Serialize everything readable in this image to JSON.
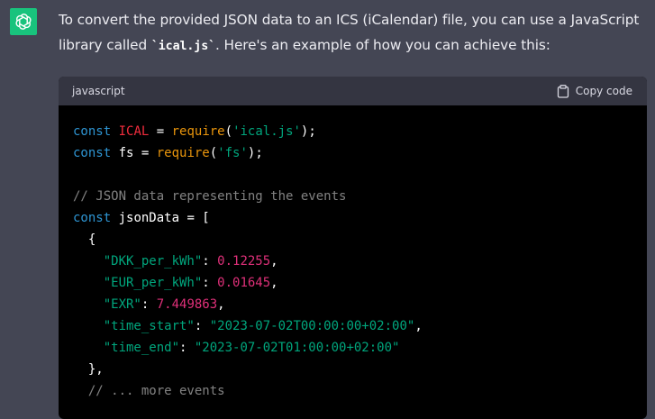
{
  "assistant": {
    "avatar_icon": "openai-logo-icon",
    "avatar_color": "#19c37d"
  },
  "message": {
    "intro_before": "To convert the provided JSON data to an ICS (iCalendar) file, you can use a JavaScript library called ",
    "intro_code": "`ical.js`",
    "intro_after": ". Here's an example of how you can achieve this:"
  },
  "code_block": {
    "language": "javascript",
    "copy_label": "Copy code",
    "copy_icon": "clipboard-icon",
    "lines": [
      [
        {
          "t": "kw",
          "v": "const"
        },
        {
          "t": "pl",
          "v": " "
        },
        {
          "t": "var",
          "v": "ICAL"
        },
        {
          "t": "pl",
          "v": " = "
        },
        {
          "t": "fn",
          "v": "require"
        },
        {
          "t": "pl",
          "v": "("
        },
        {
          "t": "str",
          "v": "'ical.js'"
        },
        {
          "t": "pl",
          "v": ");"
        }
      ],
      [
        {
          "t": "kw",
          "v": "const"
        },
        {
          "t": "pl",
          "v": " fs = "
        },
        {
          "t": "fn",
          "v": "require"
        },
        {
          "t": "pl",
          "v": "("
        },
        {
          "t": "str",
          "v": "'fs'"
        },
        {
          "t": "pl",
          "v": ");"
        }
      ],
      [],
      [
        {
          "t": "cm",
          "v": "// JSON data representing the events"
        }
      ],
      [
        {
          "t": "kw",
          "v": "const"
        },
        {
          "t": "pl",
          "v": " jsonData = ["
        }
      ],
      [
        {
          "t": "pl",
          "v": "  {"
        }
      ],
      [
        {
          "t": "pl",
          "v": "    "
        },
        {
          "t": "str",
          "v": "\"DKK_per_kWh\""
        },
        {
          "t": "pl",
          "v": ": "
        },
        {
          "t": "num",
          "v": "0.12255"
        },
        {
          "t": "pl",
          "v": ","
        }
      ],
      [
        {
          "t": "pl",
          "v": "    "
        },
        {
          "t": "str",
          "v": "\"EUR_per_kWh\""
        },
        {
          "t": "pl",
          "v": ": "
        },
        {
          "t": "num",
          "v": "0.01645"
        },
        {
          "t": "pl",
          "v": ","
        }
      ],
      [
        {
          "t": "pl",
          "v": "    "
        },
        {
          "t": "str",
          "v": "\"EXR\""
        },
        {
          "t": "pl",
          "v": ": "
        },
        {
          "t": "num",
          "v": "7.449863"
        },
        {
          "t": "pl",
          "v": ","
        }
      ],
      [
        {
          "t": "pl",
          "v": "    "
        },
        {
          "t": "str",
          "v": "\"time_start\""
        },
        {
          "t": "pl",
          "v": ": "
        },
        {
          "t": "str",
          "v": "\"2023-07-02T00:00:00+02:00\""
        },
        {
          "t": "pl",
          "v": ","
        }
      ],
      [
        {
          "t": "pl",
          "v": "    "
        },
        {
          "t": "str",
          "v": "\"time_end\""
        },
        {
          "t": "pl",
          "v": ": "
        },
        {
          "t": "str",
          "v": "\"2023-07-02T01:00:00+02:00\""
        }
      ],
      [
        {
          "t": "pl",
          "v": "  },"
        }
      ],
      [
        {
          "t": "pl",
          "v": "  "
        },
        {
          "t": "cm",
          "v": "// ... more events"
        }
      ]
    ]
  },
  "colors": {
    "page_background": "#444654",
    "code_background": "#000000",
    "code_header_background": "#343541",
    "keyword": "#2e95d3",
    "variable": "#f22c3d",
    "function": "#e9950c",
    "string": "#00a67d",
    "number": "#df3079"
  }
}
